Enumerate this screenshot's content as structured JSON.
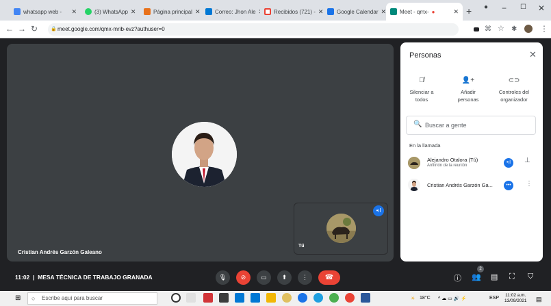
{
  "browser": {
    "tabs": [
      {
        "label": "whatsapp web - ",
        "fav_color": "#4285f4"
      },
      {
        "label": "(3) WhatsApp",
        "fav_color": "#25d366"
      },
      {
        "label": "Página principal",
        "fav_color": "#e8711a"
      },
      {
        "label": "Correo: Jhon Ale",
        "fav_color": "#0078d4"
      },
      {
        "label": "Recibidos (721) -",
        "fav_color": "#ea4335"
      },
      {
        "label": "Google Calendar",
        "fav_color": "#1a73e8"
      },
      {
        "label": "Meet - qmx-",
        "fav_color": "#00897b"
      }
    ],
    "url": "meet.google.com/qmx-mrib-evz?authuser=0"
  },
  "meeting": {
    "main_participant": "Cristian Andrés Garzón Galeano",
    "self_label": "Tú",
    "time": "11:02",
    "separator": "|",
    "title": "MESA TÉCNICA DE TRABAJO GRANADA"
  },
  "panel": {
    "title": "Personas",
    "actions": [
      {
        "line1": "Silenciar a",
        "line2": "todos",
        "icon": "mute-all-icon"
      },
      {
        "line1": "Añadir",
        "line2": "personas",
        "icon": "add-person-icon"
      },
      {
        "line1": "Controles del",
        "line2": "organizador",
        "icon": "host-controls-icon"
      }
    ],
    "search_placeholder": "Buscar a gente",
    "section": "En la llamada",
    "participants": [
      {
        "name": "Alejandro Otalora (Tú)",
        "subtitle": "Anfitrión de la reunión"
      },
      {
        "name": "Cristian Andrés Garzón Ga...",
        "subtitle": ""
      }
    ]
  },
  "controls": {
    "people_count": "2"
  },
  "taskbar": {
    "search_placeholder": "Escribe aquí para buscar",
    "weather": "18°C",
    "language": "ESP",
    "time": "11:02 a.m.",
    "date": "13/09/2021"
  }
}
